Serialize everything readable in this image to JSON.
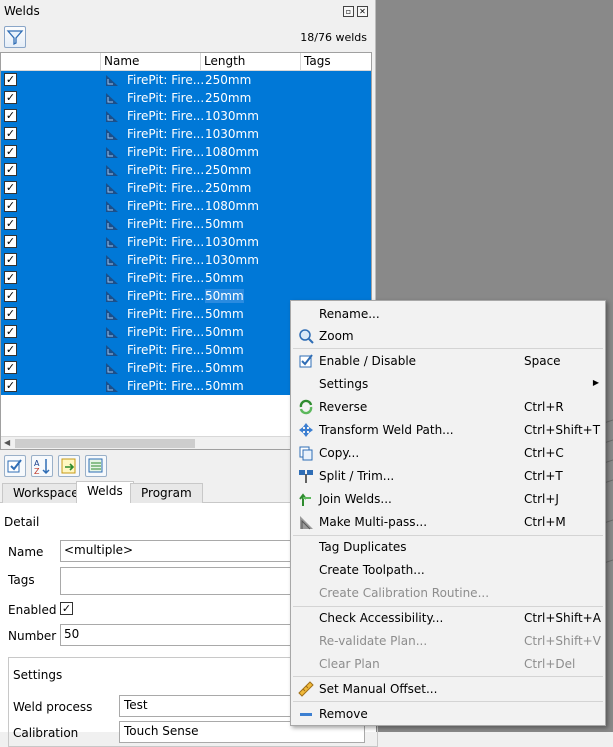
{
  "panel": {
    "title": "Welds",
    "count": "18/76 welds"
  },
  "table": {
    "headers": [
      "Name",
      "Length",
      "Tags"
    ],
    "rows": [
      {
        "name": "FirePit: Fire...",
        "length": "250mm"
      },
      {
        "name": "FirePit: Fire...",
        "length": "250mm"
      },
      {
        "name": "FirePit: Fire...",
        "length": "1030mm"
      },
      {
        "name": "FirePit: Fire...",
        "length": "1030mm"
      },
      {
        "name": "FirePit: Fire...",
        "length": "1080mm"
      },
      {
        "name": "FirePit: Fire...",
        "length": "250mm"
      },
      {
        "name": "FirePit: Fire...",
        "length": "250mm"
      },
      {
        "name": "FirePit: Fire...",
        "length": "1080mm"
      },
      {
        "name": "FirePit: Fire...",
        "length": "50mm"
      },
      {
        "name": "FirePit: Fire...",
        "length": "1030mm"
      },
      {
        "name": "FirePit: Fire...",
        "length": "1030mm"
      },
      {
        "name": "FirePit: Fire...",
        "length": "50mm"
      },
      {
        "name": "FirePit: Fire...",
        "length": "50mm"
      },
      {
        "name": "FirePit: Fire...",
        "length": "50mm"
      },
      {
        "name": "FirePit: Fire...",
        "length": "50mm"
      },
      {
        "name": "FirePit: Fire...",
        "length": "50mm"
      },
      {
        "name": "FirePit: Fire...",
        "length": "50mm"
      },
      {
        "name": "FirePit: Fire...",
        "length": "50mm"
      }
    ]
  },
  "tabs": [
    "Workspace",
    "Welds",
    "Program"
  ],
  "detail": {
    "heading": "Detail",
    "name_label": "Name",
    "name_value": "<multiple>",
    "tags_label": "Tags",
    "tags_value": "",
    "enabled_label": "Enabled",
    "number_label": "Number",
    "number_value": "50",
    "settings_label": "Settings",
    "weld_process_label": "Weld process",
    "weld_process_value": "Test",
    "calibration_label": "Calibration",
    "calibration_value": "Touch Sense"
  },
  "menu": {
    "rename": "Rename...",
    "zoom": "Zoom",
    "enable": "Enable / Disable",
    "enable_key": "Space",
    "settings": "Settings",
    "reverse": "Reverse",
    "reverse_key": "Ctrl+R",
    "transform": "Transform Weld Path...",
    "transform_key": "Ctrl+Shift+T",
    "copy": "Copy...",
    "copy_key": "Ctrl+C",
    "split": "Split / Trim...",
    "split_key": "Ctrl+T",
    "join": "Join Welds...",
    "join_key": "Ctrl+J",
    "multipass": "Make Multi-pass...",
    "multipass_key": "Ctrl+M",
    "tagdup": "Tag Duplicates",
    "toolpath": "Create Toolpath...",
    "calroutine": "Create Calibration Routine...",
    "access": "Check Accessibility...",
    "access_key": "Ctrl+Shift+A",
    "revalidate": "Re-validate Plan...",
    "revalidate_key": "Ctrl+Shift+V",
    "clearplan": "Clear Plan",
    "clearplan_key": "Ctrl+Del",
    "offset": "Set Manual Offset...",
    "remove": "Remove"
  },
  "colors": {
    "selection": "#0078d7",
    "viewport": "#898989"
  }
}
